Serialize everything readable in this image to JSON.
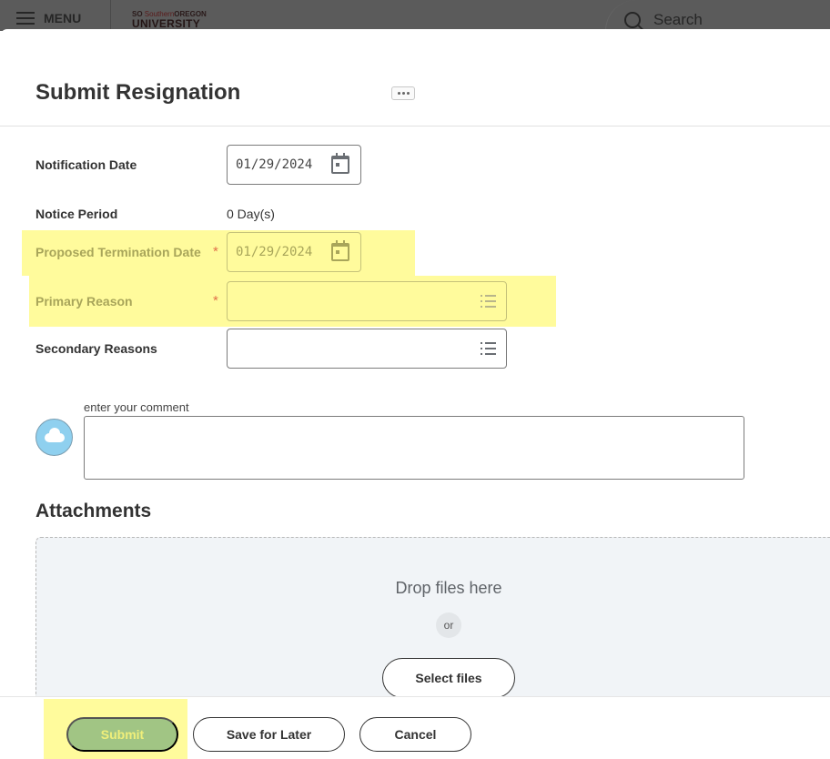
{
  "topbar": {
    "menu_label": "MENU",
    "logo_line1_prefix": "SO",
    "logo_line1_red": "Southern",
    "logo_line1_bold": "OREGON",
    "logo_line2": "UNIVERSITY",
    "search_label": "Search"
  },
  "page": {
    "title": "Submit Resignation"
  },
  "form": {
    "notification_date": {
      "label": "Notification Date",
      "value": "01/29/2024"
    },
    "notice_period": {
      "label": "Notice Period",
      "value": "0 Day(s)"
    },
    "proposed_termination_date": {
      "label": "Proposed Termination Date",
      "required_mark": "*",
      "value": "01/29/2024"
    },
    "primary_reason": {
      "label": "Primary Reason",
      "required_mark": "*",
      "value": ""
    },
    "secondary_reasons": {
      "label": "Secondary Reasons",
      "value": ""
    }
  },
  "comment": {
    "label": "enter your comment",
    "value": ""
  },
  "attachments": {
    "title": "Attachments",
    "drop_text": "Drop files here",
    "or_text": "or",
    "select_files_label": "Select files"
  },
  "footer": {
    "submit_label": "Submit",
    "save_label": "Save for Later",
    "cancel_label": "Cancel"
  },
  "colors": {
    "highlight": "#fffb9c",
    "submit_bg": "#a1c584",
    "required": "#e0704b",
    "topbar": "#5b5b5b"
  }
}
